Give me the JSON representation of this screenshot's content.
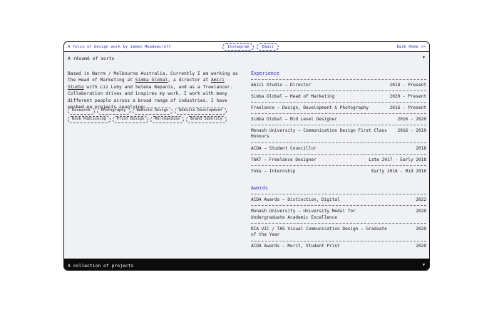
{
  "topbar": {
    "site_label": "A folio of design work by James Meadowcroft",
    "links": [
      "Instagram",
      "Email"
    ],
    "back_home": "Back Home >>"
  },
  "resume": {
    "title": "A résumé of sorts",
    "toggle_icon": "triangle-down-icon",
    "bio": {
      "part1": "Based in Narrm / Melbourne Australia. Currently I am working as the Head of Marketing at ",
      "link1": "Simba Global",
      "part2": ", a director at ",
      "link2": "Amici Studio",
      "part3": " with Liz Luby and Selena Repanis, and as a freelancer. Collaboration drives and inspires my work. I work with many different people across a broad range of industries. I have worked on projects involving:"
    },
    "tags": [
      "Research",
      "Photography",
      "Website Design",
      "Website Development",
      "Book Publishing",
      "Print Design",
      "Merchandise",
      "Brand Identity"
    ]
  },
  "experience": {
    "heading": "Experience",
    "items": [
      {
        "role": "Amici Studio — Director",
        "dates": "2018 - Present"
      },
      {
        "role": "Simba Global — Head of Marketing",
        "dates": "2020 - Present"
      },
      {
        "role": "Freelance — Design, Development & Photography",
        "dates": "2016 - Present"
      },
      {
        "role": "Simba Global — Mid Level Designer",
        "dates": "2016 - 2020"
      },
      {
        "role": "Monash University — Communication Design First Class Honours",
        "dates": "2016 - 2019"
      },
      {
        "role": "ACDA — Student Councillor",
        "dates": "2018"
      },
      {
        "role": "TAKT — Freelance Designer",
        "dates": "Late 2017 - Early 2018"
      },
      {
        "role": "Yoke — Internship",
        "dates": "Early 2016 - Mid 2016"
      }
    ]
  },
  "awards": {
    "heading": "Awards",
    "items": [
      {
        "name": "ACDA Awards — Distinction, Digital",
        "year": "2022"
      },
      {
        "name": "Monash University — University Medal for Undergraduate Academic Excellence",
        "year": "2020"
      },
      {
        "name": "DIA VIC / TAS Visual Communication Design — Graduate of the Year",
        "year": "2020"
      },
      {
        "name": "ACDA Awards — Merit, Student Print",
        "year": "2020"
      }
    ]
  },
  "projects": {
    "title": "A collection of projects",
    "toggle_icon": "triangle-down-icon"
  }
}
